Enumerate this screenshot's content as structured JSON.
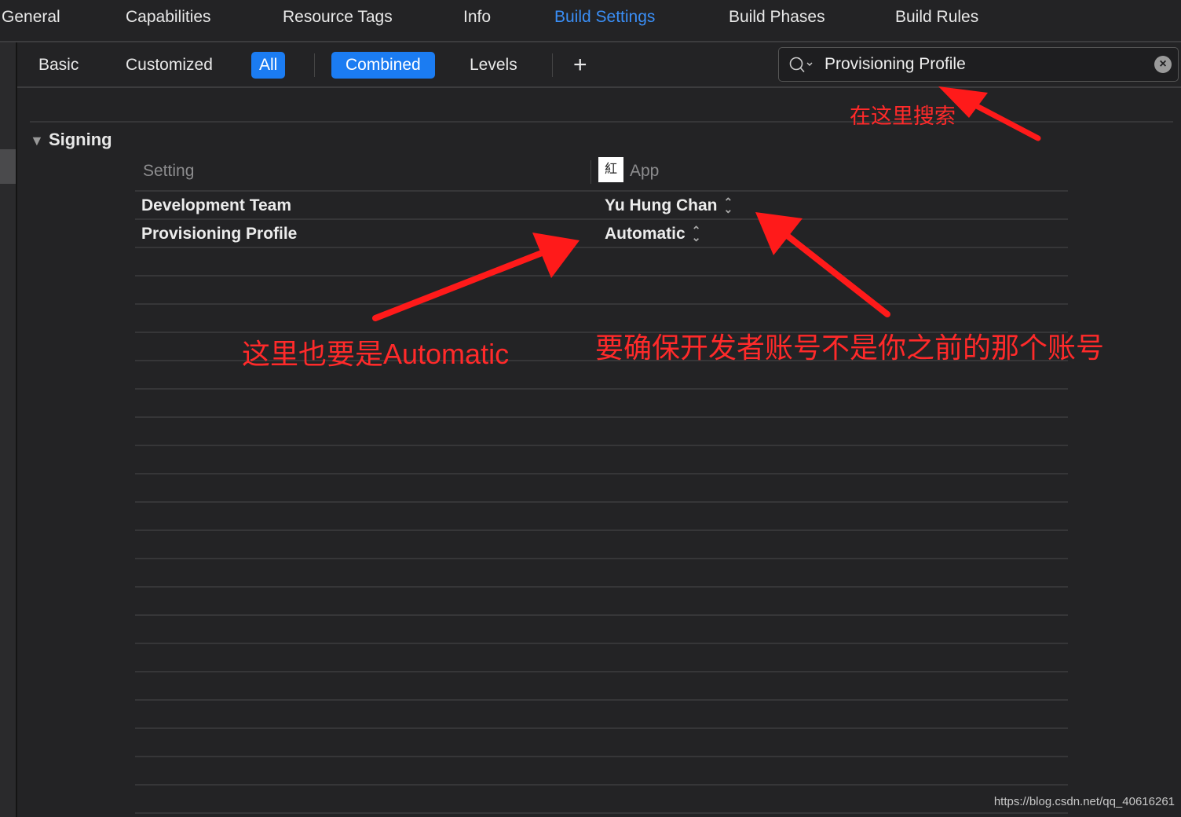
{
  "tabs": [
    {
      "label": "General",
      "active": false
    },
    {
      "label": "Capabilities",
      "active": false
    },
    {
      "label": "Resource Tags",
      "active": false
    },
    {
      "label": "Info",
      "active": false
    },
    {
      "label": "Build Settings",
      "active": true
    },
    {
      "label": "Build Phases",
      "active": false
    },
    {
      "label": "Build Rules",
      "active": false
    }
  ],
  "filters": {
    "basic": "Basic",
    "customized": "Customized",
    "all": "All",
    "combined": "Combined",
    "levels": "Levels",
    "add": "+"
  },
  "search": {
    "value": "Provisioning Profile",
    "icon": "search-icon",
    "clear_icon": "clear-icon"
  },
  "section": {
    "title": "Signing",
    "expanded": true
  },
  "table": {
    "headers": {
      "setting": "Setting",
      "target": "App"
    },
    "rows": [
      {
        "setting": "Development Team",
        "value": "Yu Hung Chan"
      },
      {
        "setting": "Provisioning Profile",
        "value": "Automatic"
      }
    ]
  },
  "annotations": {
    "search_here": "在这里搜索",
    "also_automatic": "这里也要是Automatic",
    "ensure_account": "要确保开发者账号不是你之前的那个账号"
  },
  "watermark": "https://blog.csdn.net/qq_40616261",
  "colors": {
    "accent": "#1b7cf2",
    "annotation": "#ff1a1a",
    "background": "#232325"
  }
}
